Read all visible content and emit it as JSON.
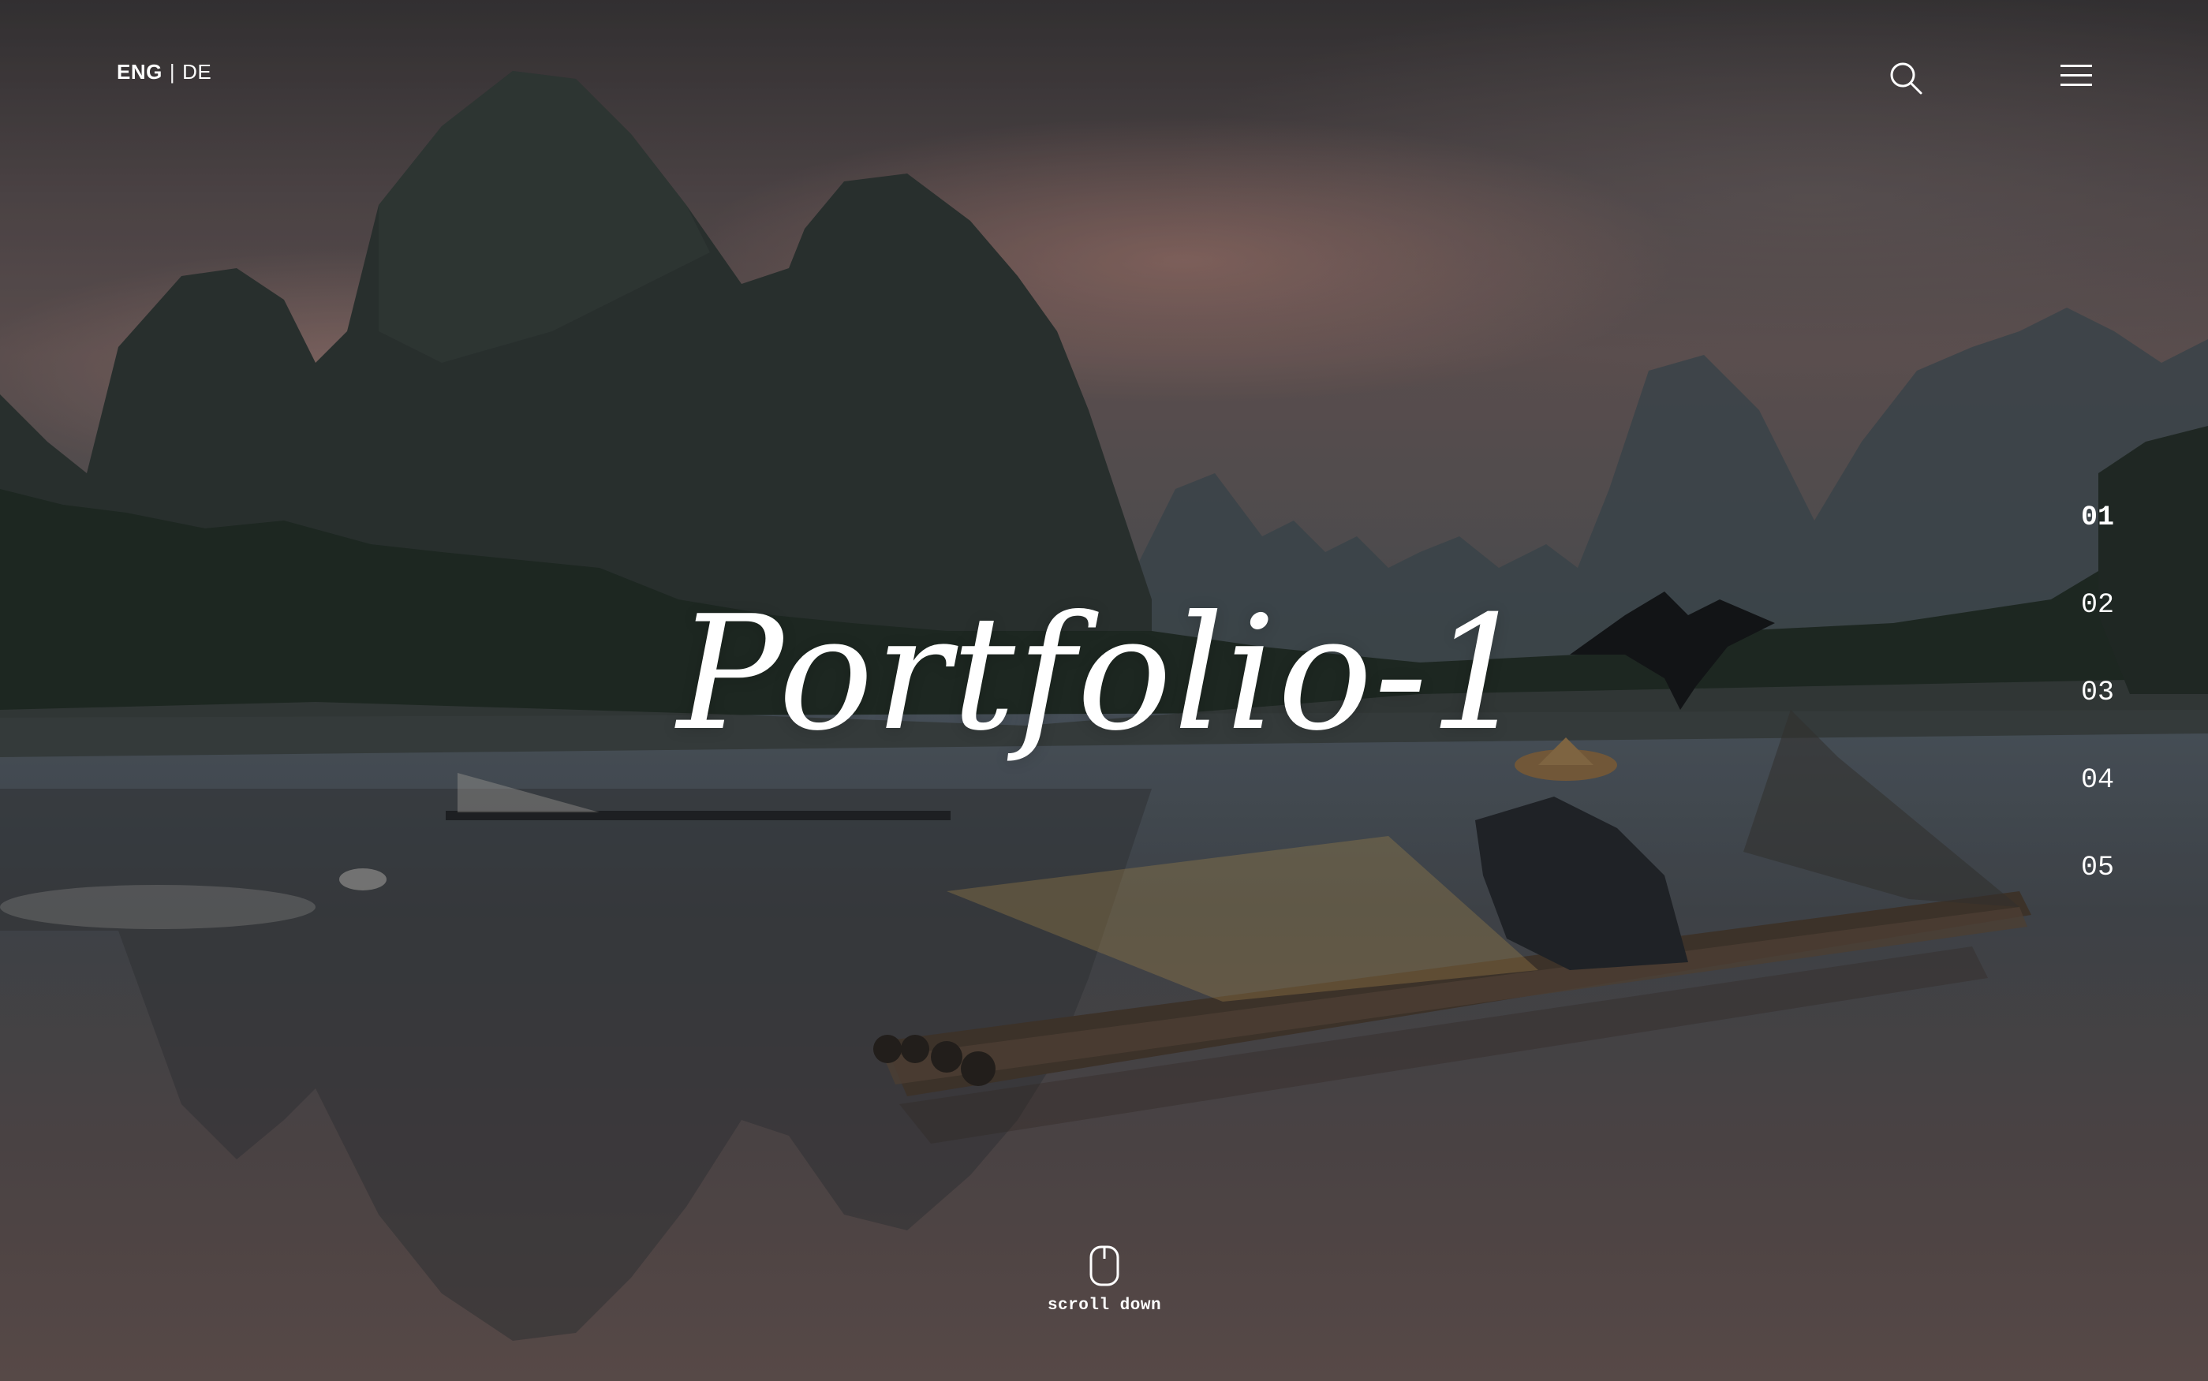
{
  "header": {
    "lang_active": "ENG",
    "lang_separator": "|",
    "lang_other": "DE",
    "search_icon": "search-icon",
    "menu_icon": "hamburger-menu-icon"
  },
  "hero": {
    "title": "Portfolio-1"
  },
  "slides_nav": {
    "items": [
      "01",
      "02",
      "03",
      "04",
      "05"
    ],
    "active_index": 0
  },
  "scroll": {
    "label": "scroll down",
    "icon": "mouse-icon"
  },
  "colors": {
    "text": "#ffffff"
  }
}
